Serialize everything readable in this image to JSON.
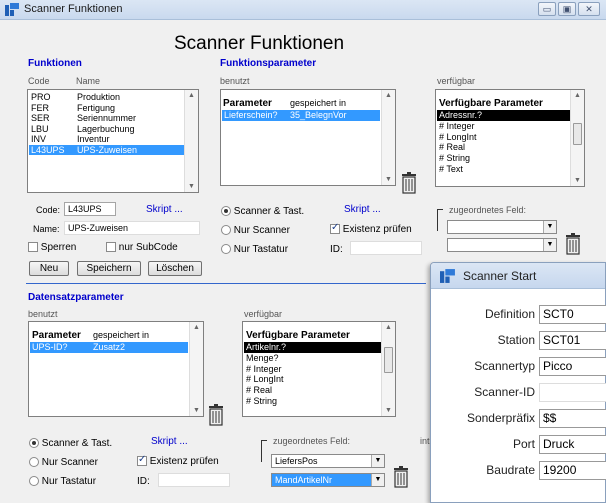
{
  "window": {
    "title": "Scanner Funktionen",
    "heading": "Scanner Funktionen"
  },
  "funktionen": {
    "title": "Funktionen",
    "col_code": "Code",
    "col_name": "Name",
    "rows": [
      {
        "code": "PRO",
        "name": "Produktion"
      },
      {
        "code": "FER",
        "name": "Fertigung"
      },
      {
        "code": "SER",
        "name": "Seriennummer"
      },
      {
        "code": "LBU",
        "name": "Lagerbuchung"
      },
      {
        "code": "INV",
        "name": "Inventur"
      },
      {
        "code": "L43UPS",
        "name": "UPS-Zuweisen"
      }
    ],
    "code_label": "Code:",
    "code_value": "L43UPS",
    "skript_label": "Skript ...",
    "name_label": "Name:",
    "name_value": "UPS-Zuweisen",
    "sperren_label": "Sperren",
    "subcode_label": "nur SubCode",
    "btn_neu": "Neu",
    "btn_speichern": "Speichern",
    "btn_loeschen": "Löschen"
  },
  "funktionsparameter": {
    "title": "Funktionsparameter",
    "benutzt": "benutzt",
    "verfuegbar": "verfügbar",
    "col_param": "Parameter",
    "col_saved": "gespeichert in",
    "used_rows": [
      {
        "param": "Lieferschein?",
        "saved": "35_BelegnVor"
      }
    ],
    "avail_header": "Verfügbare Parameter",
    "avail_rows": [
      "Adressnr.?",
      "# Integer",
      "# LongInt",
      "# Real",
      "# String",
      "# Text"
    ],
    "radio_scanner_tast": "Scanner & Tast.",
    "radio_nur_scanner": "Nur Scanner",
    "radio_nur_tastatur": "Nur Tastatur",
    "skript_label": "Skript ...",
    "existenz_label": "Existenz prüfen",
    "id_label": "ID:",
    "zugeordnet_label": "zugeordnetes Feld:"
  },
  "datensatzparameter": {
    "title": "Datensatzparameter",
    "benutzt": "benutzt",
    "verfuegbar": "verfügbar",
    "col_param": "Parameter",
    "col_saved": "gespeichert in",
    "used_rows": [
      {
        "param": "UPS-ID?",
        "saved": "Zusatz2"
      }
    ],
    "avail_header": "Verfügbare Parameter",
    "avail_rows": [
      "Artikelnr.?",
      "Menge?",
      "# Integer",
      "# LongInt",
      "# Real",
      "# String"
    ],
    "radio_scanner_tast": "Scanner & Tast.",
    "radio_nur_scanner": "Nur Scanner",
    "radio_nur_tastatur": "Nur Tastatur",
    "skript_label": "Skript ...",
    "existenz_label": "Existenz prüfen",
    "id_label": "ID:",
    "zugeordnet_label": "zugeordnetes Feld:",
    "combo1": "LiefersPos",
    "combo2": "MandArtikelNr",
    "int_label": "int"
  },
  "scanner_start": {
    "title": "Scanner Start",
    "fields": [
      {
        "label": "Definition",
        "value": "SCT0"
      },
      {
        "label": "Station",
        "value": "SCT01"
      },
      {
        "label": "Scannertyp",
        "value": "Picco"
      },
      {
        "label": "Scanner-ID",
        "value": ""
      },
      {
        "label": "Sonderpräfix",
        "value": "$$"
      },
      {
        "label": "Port",
        "value": "Druck"
      },
      {
        "label": "Baudrate",
        "value": "19200"
      }
    ]
  },
  "colors": {
    "section_title": "#0000cc",
    "selection": "#3399ff",
    "link": "#0000cc"
  }
}
